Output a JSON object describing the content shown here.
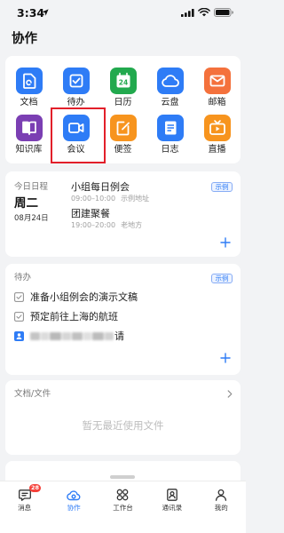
{
  "status_bar": {
    "time": "3:34",
    "icons": [
      "location-arrow-icon",
      "signal-icon",
      "wifi-icon",
      "battery-icon"
    ]
  },
  "header": {
    "title": "协作"
  },
  "apps": [
    {
      "label": "文档",
      "icon": "document-icon",
      "color": "#2e7cf6"
    },
    {
      "label": "待办",
      "icon": "todo-check-icon",
      "color": "#2e7cf6"
    },
    {
      "label": "日历",
      "icon": "calendar-icon",
      "color": "#22a94e",
      "icon_text": "24"
    },
    {
      "label": "云盘",
      "icon": "cloud-icon",
      "color": "#2e7cf6"
    },
    {
      "label": "邮箱",
      "icon": "mail-icon",
      "color": "#f4713c"
    },
    {
      "label": "知识库",
      "icon": "book-icon",
      "color": "#7b3fb3"
    },
    {
      "label": "会议",
      "icon": "video-camera-icon",
      "color": "#2e7cf6"
    },
    {
      "label": "便签",
      "icon": "note-icon",
      "color": "#f7941e"
    },
    {
      "label": "日志",
      "icon": "log-icon",
      "color": "#2e7cf6"
    },
    {
      "label": "直播",
      "icon": "tv-icon",
      "color": "#f7941e"
    }
  ],
  "highlighted_app": "会议",
  "schedule": {
    "title": "今日日程",
    "weekday": "周二",
    "date": "08月24日",
    "badge": "示例",
    "events": [
      {
        "title": "小组每日例会",
        "time": "09:00–10:00",
        "place": "示例地址"
      },
      {
        "title": "团建聚餐",
        "time": "19:00–20:00",
        "place": "老地方"
      }
    ],
    "add_icon": "plus-icon"
  },
  "todo": {
    "title": "待办",
    "badge": "示例",
    "items": [
      "准备小组例会的演示文稿",
      "预定前往上海的航班"
    ],
    "invite_suffix": "请",
    "add_icon": "plus-icon"
  },
  "docs": {
    "title": "文档/文件",
    "empty": "暂无最近使用文件",
    "more_icon": "chevron-right-icon"
  },
  "tabs": [
    {
      "label": "消息",
      "icon": "message-icon",
      "badge": "28",
      "active": false
    },
    {
      "label": "协作",
      "icon": "collab-icon",
      "active": true
    },
    {
      "label": "工作台",
      "icon": "workbench-icon",
      "active": false
    },
    {
      "label": "通讯录",
      "icon": "contacts-icon",
      "active": false
    },
    {
      "label": "我的",
      "icon": "profile-icon",
      "active": false
    }
  ],
  "colors": {
    "accent": "#2e7cf6",
    "highlight": "#e21f2a",
    "badge_red": "#f5413a",
    "background": "#f2f3f5"
  }
}
